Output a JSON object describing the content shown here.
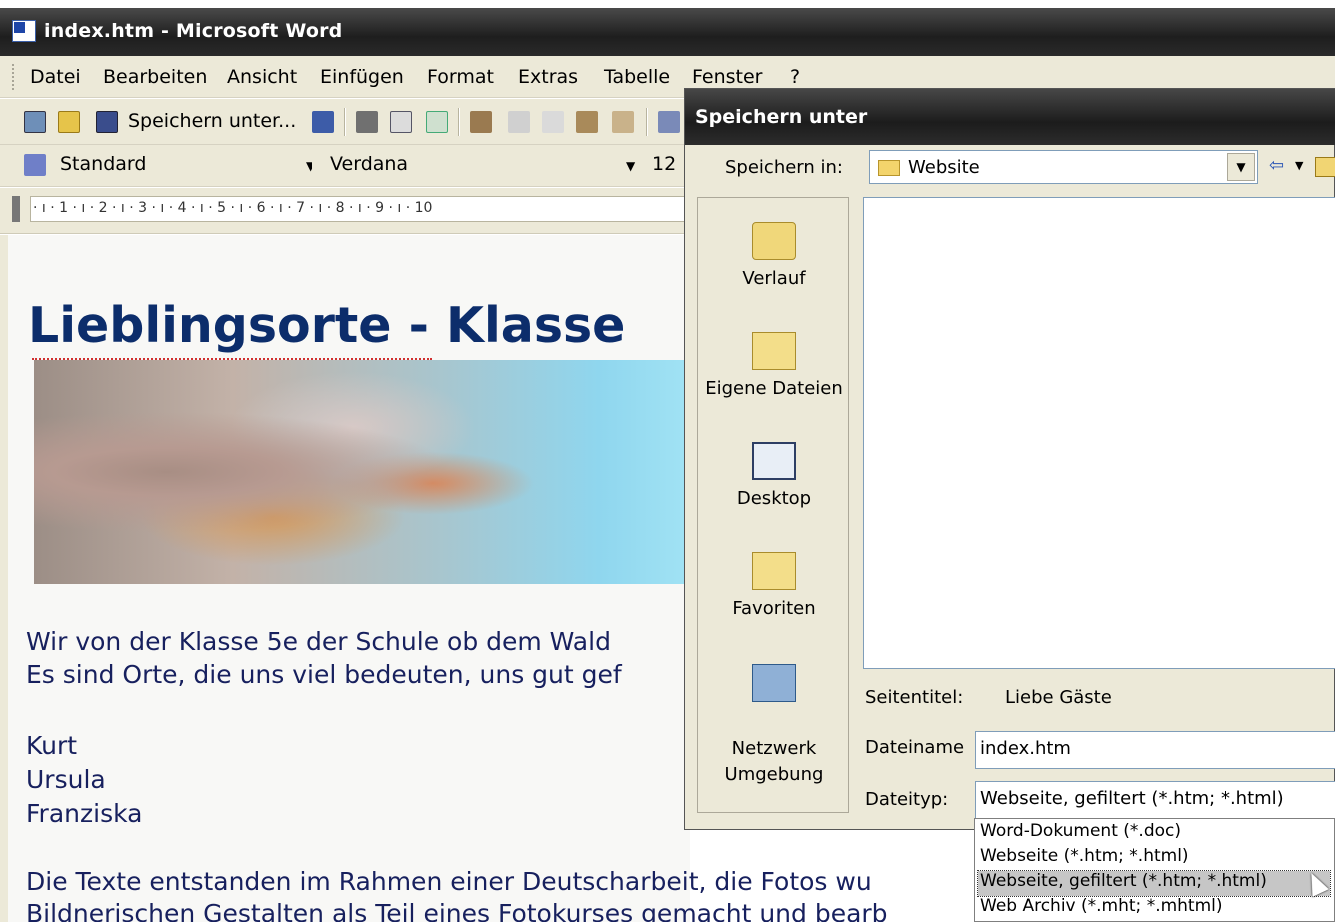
{
  "window": {
    "title": "index.htm - Microsoft Word",
    "app_icon": "word-icon"
  },
  "menu": [
    "Datei",
    "Bearbeiten",
    "Ansicht",
    "Einfügen",
    "Format",
    "Extras",
    "Tabelle",
    "Fenster",
    "?"
  ],
  "toolbar": {
    "save_as_label": "Speichern unter...",
    "style_value": "Standard",
    "font_value": "Verdana",
    "size_value": "12"
  },
  "ruler": {
    "text": "· ı · 1 · ı · 2 · ı · 3 · ı · 4 · ı · 5 · ı · 6 · ı · 7 · ı · 8 · ı · 9 · ı · 10"
  },
  "document": {
    "heading": "Lieblingsorte - Klasse",
    "lines": [
      "Wir von der Klasse 5e der Schule ob dem Wald",
      "Es sind Orte, die uns viel bedeuten, uns gut gef",
      "Kurt",
      "Ursula",
      "Franziska",
      "Die Texte entstanden im Rahmen einer Deutscharbeit, die Fotos wu",
      "Bildnerischen Gestalten als Teil eines Fotokurses gemacht und bearb"
    ]
  },
  "dialog": {
    "title": "Speichern unter",
    "save_in_label": "Speichern in:",
    "save_in_value": "Website",
    "places": [
      "Verlauf",
      "Eigene Dateien",
      "Desktop",
      "Favoriten",
      "Netzwerk\nUmgebung"
    ],
    "page_title_label": "Seitentitel:",
    "page_title_value": "Liebe Gäste",
    "filename_label": "Dateiname",
    "filename_value": "index.htm",
    "filetype_label": "Dateityp:",
    "filetype_value": "Webseite, gefiltert (*.htm; *.html)",
    "filetype_options": [
      "Word-Dokument (*.doc)",
      "Webseite (*.htm; *.html)",
      "Webseite, gefiltert (*.htm; *.html)",
      "Web Archiv (*.mht; *.mhtml)"
    ],
    "filetype_selected_index": 2
  },
  "colors": {
    "heading": "#0c2d6b",
    "body_text": "#17205e",
    "chrome": "#ece9d8"
  }
}
